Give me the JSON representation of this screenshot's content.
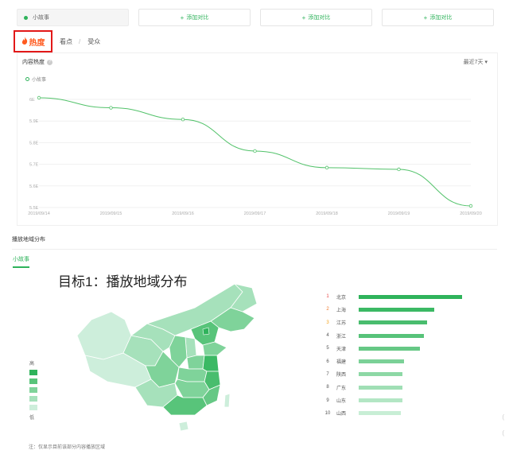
{
  "topbar": {
    "selected": "小故事",
    "add_labels": [
      "添加对比",
      "添加对比",
      "添加对比"
    ]
  },
  "tabs": {
    "hot": "热度",
    "view": "看点",
    "audience": "受众",
    "separator": "/"
  },
  "trend": {
    "title": "内容热度",
    "range": "最近7天 ▾",
    "legend": "小故事"
  },
  "chart_data": {
    "type": "line",
    "x": [
      "2019/09/14",
      "2019/09/15",
      "2019/09/16",
      "2019/09/17",
      "2019/09/18",
      "2019/09/19",
      "2019/09/20"
    ],
    "series": [
      {
        "name": "小故事",
        "values": [
          6.0,
          5.94,
          5.87,
          5.68,
          5.58,
          5.57,
          5.35
        ]
      }
    ],
    "yticks": [
      "6E",
      "5.9E",
      "5.8E",
      "5.7E",
      "5.6E",
      "5.5E"
    ],
    "ylim": [
      5.35,
      6.0
    ],
    "grid": true,
    "color": "#52c26a"
  },
  "region": {
    "title": "播放地域分布",
    "tab": "小故事",
    "target_title": "目标1：播放地域分布",
    "legend_high": "高",
    "legend_low": "低",
    "legend_colors": [
      "#2fb35b",
      "#58c47a",
      "#7fd39a",
      "#a6e1bb",
      "#cdeedb"
    ],
    "ranking": [
      {
        "rank": "1",
        "name": "北京",
        "value": 100,
        "color": "#2fb35b",
        "rank_color": "#e84545"
      },
      {
        "rank": "2",
        "name": "上海",
        "value": 73,
        "color": "#3bb964",
        "rank_color": "#f07a2b"
      },
      {
        "rank": "3",
        "name": "江苏",
        "value": 66,
        "color": "#49bd6e",
        "rank_color": "#f5a623"
      },
      {
        "rank": "4",
        "name": "浙江",
        "value": 63,
        "color": "#57c379",
        "rank_color": "#555555"
      },
      {
        "rank": "5",
        "name": "天津",
        "value": 59,
        "color": "#66c885",
        "rank_color": "#555555"
      },
      {
        "rank": "6",
        "name": "福建",
        "value": 44,
        "color": "#7bd197",
        "rank_color": "#555555"
      },
      {
        "rank": "7",
        "name": "陕西",
        "value": 42,
        "color": "#8dd8a5",
        "rank_color": "#555555"
      },
      {
        "rank": "8",
        "name": "广东",
        "value": 42,
        "color": "#a0dfb5",
        "rank_color": "#555555"
      },
      {
        "rank": "9",
        "name": "山东",
        "value": 42,
        "color": "#b3e6c4",
        "rank_color": "#555555"
      },
      {
        "rank": "10",
        "name": "山西",
        "value": 41,
        "color": "#c8eed5",
        "rank_color": "#555555"
      }
    ],
    "footnote": "注：仅显示目前该部分内容播放区域"
  }
}
